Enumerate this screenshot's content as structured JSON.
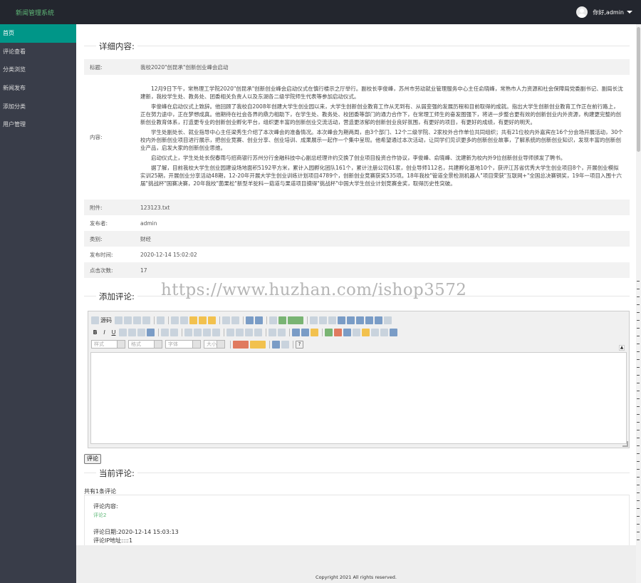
{
  "header": {
    "brand": "新闻管理系统",
    "user_greeting": "你好,admin"
  },
  "sidebar": {
    "items": [
      {
        "label": "首页",
        "active": true
      },
      {
        "label": "评论查看"
      },
      {
        "label": "分类浏览"
      },
      {
        "label": "新闻发布"
      },
      {
        "label": "添加分类"
      },
      {
        "label": "用户管理"
      }
    ]
  },
  "detail": {
    "legend": "详细内容:",
    "title_label": "标题:",
    "title_value": "我校2020\"创昆承\"创新创业峰会启动",
    "content_label": "内容:",
    "paragraphs": [
      "12月9日下午，常熟理工学院2020\"创昆承\"创新创业峰会启动仪式在慎行楼示之厅举行。副校长李俊峰，苏州市劳动就业管理服务中心主任俞晓峰，常熟市人力资源和社会保障局党委副书记、副局长沈建新，我校学生处、教务处、团委相关负责人以及东湖各二级学院师生代表等参加启动仪式。",
      "李俊峰在启动仪式上致辞。他回顾了我校自2008年创建大学生创业园以来，大学生创新创业教育工作从无到有、从弱变强的发展历程和目前取得的成就。指出大学生创新创业教育工作正在前行路上，正在努力途中，正在梦想成真。他期待在社会各界的鼎力相助下，在学生处、教务处、校团委等部门的通力合作下，在常理工师生的奋发图强下，将进一步整合更有效的创新创业内外资源，构建更完整的创新创业教育体系，打造更专业的创新创业孵化平台，组织更丰富的创新创业交流活动，营造更浓郁的创新创业良好氛围，有更好的项目，有更好的成绩，有更好的明天。",
      "学生处副处长、就业指导中心主任梁秀生介绍了本次峰会的准备情况。本次峰会为期两周，由3个部门、12个二级学院、2家校外合作单位共同组织；共有21位校内外嘉宾在16个分会场开展活动，30个校内外创新创业项目进行展示，把创业竞赛、创业分享、创业培训、成果展示一起作一个集中呈现。他希望通过本次活动，让同学们见识更多的创新创业故事，了解系统的创新创业知识，发现丰富的创新创业产品，启发大家的创新创业思维。",
      "启动仪式上，学生处处长倪春雨与招商银行苏州分行金融科技中心副总经理许约交换了创业项目投资合作协议，李俊峰、俞晓峰、沈建新为校内外9位创新创业导师颁发了聘书。",
      "据了解，目前我校大学生创业园建设场地面积5192平方米，累计入园孵化团队161个，累计注册公司61家，创业导师112名，共建孵化基地10个，获评江苏省优秀大学生创业项目8个，开展创业模拟实训25期，开展创业分享活动48期，12-20年开展大学生创业训练计划项目4789个，创新创业竞赛获奖535项。18年我校\"管道全景检测机器人\"项目荣获\"互联网+\"全国总决赛铜奖，19年一项目入围十六届\"挑战杯\"国赛决赛，20年我校\"菌果松\"新型羊驼科一菇道与果道项目摘得\"挑战杯\"中国大学生创业计划竞赛金奖，取得历史性突破。"
    ],
    "rows": [
      {
        "label": "附件:",
        "value": "123123.txt"
      },
      {
        "label": "发布者:",
        "value": "admin"
      },
      {
        "label": "类别:",
        "value": "财经"
      },
      {
        "label": "发布时间:",
        "value": "2020-12-14 15:02:02"
      },
      {
        "label": "点击次数:",
        "value": "17"
      }
    ]
  },
  "add_comment": {
    "legend": "添加评论:",
    "editor": {
      "source_label": "源码",
      "bold": "B",
      "italic": "I",
      "underline": "U",
      "style_placeholder": "样式",
      "format_placeholder": "格式",
      "font_placeholder": "字体",
      "size_placeholder": "大小",
      "help": "?"
    },
    "submit_label": "评论"
  },
  "comments": {
    "legend": "当前评论:",
    "count_text": "共有1条评论",
    "items": [
      {
        "content_label": "评论内容:",
        "content": "评论2",
        "date_text": "评论日期:2020-12-14 15:03:13",
        "ip_text": "评论IP地址::::1"
      }
    ]
  },
  "footer": {
    "copyright": "Copyright 2021 All rights reserved."
  },
  "watermark": "https://www.huzhan.com/ishop3572",
  "colors": {
    "topbar": "#23262e",
    "sidebar": "#393d49",
    "active": "#009688",
    "brand": "#5fb878"
  }
}
